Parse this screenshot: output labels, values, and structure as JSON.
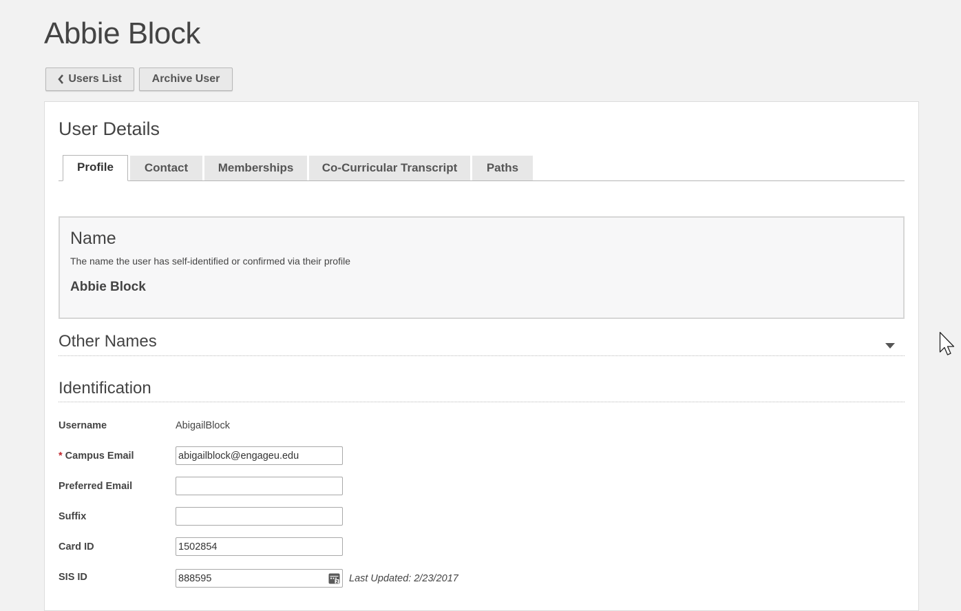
{
  "page": {
    "title": "Abbie Block"
  },
  "actions": {
    "users_list": "Users List",
    "archive_user": "Archive User"
  },
  "card": {
    "title": "User Details",
    "tabs": [
      {
        "label": "Profile",
        "active": true
      },
      {
        "label": "Contact",
        "active": false
      },
      {
        "label": "Memberships",
        "active": false
      },
      {
        "label": "Co-Curricular Transcript",
        "active": false
      },
      {
        "label": "Paths",
        "active": false
      }
    ]
  },
  "name_section": {
    "heading": "Name",
    "description": "The name the user has self-identified or confirmed via their profile",
    "value": "Abbie Block"
  },
  "other_names": {
    "heading": "Other Names",
    "icon": "caret-down-icon"
  },
  "identification": {
    "heading": "Identification",
    "fields": {
      "username": {
        "label": "Username",
        "value": "AbigailBlock"
      },
      "campus_email": {
        "label": "Campus Email",
        "required_marker": "*",
        "value": "abigailblock@engageu.edu"
      },
      "preferred_email": {
        "label": "Preferred Email",
        "value": ""
      },
      "suffix": {
        "label": "Suffix",
        "value": ""
      },
      "card_id": {
        "label": "Card ID",
        "value": "1502854"
      },
      "sis_id": {
        "label": "SIS ID",
        "value": "888595",
        "last_updated": "Last Updated: 2/23/2017",
        "icon": "calendar-icon"
      }
    }
  },
  "colors": {
    "page_background": "#f2f2f2",
    "card_background": "#ffffff",
    "required": "#c0262d",
    "button_background": "#e9e9e9"
  }
}
